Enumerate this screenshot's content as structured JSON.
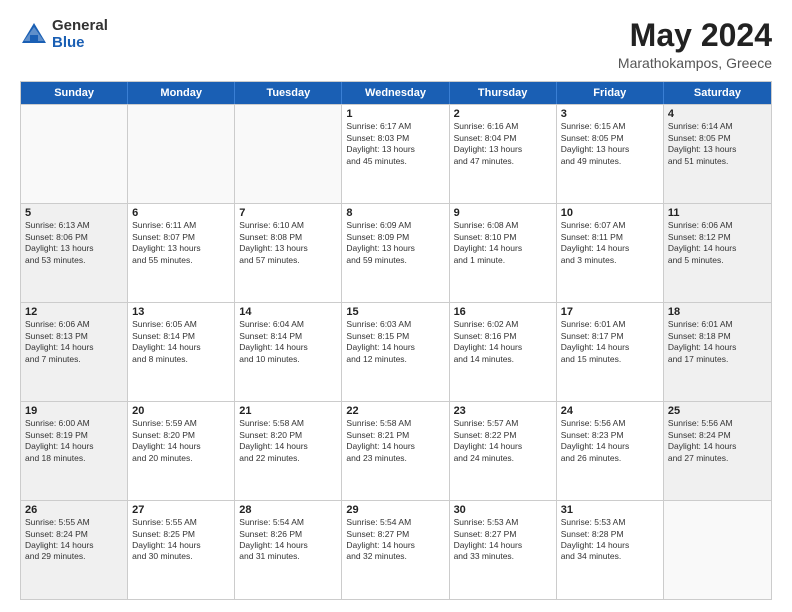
{
  "logo": {
    "general": "General",
    "blue": "Blue"
  },
  "title": "May 2024",
  "location": "Marathokampos, Greece",
  "days_of_week": [
    "Sunday",
    "Monday",
    "Tuesday",
    "Wednesday",
    "Thursday",
    "Friday",
    "Saturday"
  ],
  "weeks": [
    [
      {
        "day": "",
        "info": ""
      },
      {
        "day": "",
        "info": ""
      },
      {
        "day": "",
        "info": ""
      },
      {
        "day": "1",
        "info": "Sunrise: 6:17 AM\nSunset: 8:03 PM\nDaylight: 13 hours\nand 45 minutes."
      },
      {
        "day": "2",
        "info": "Sunrise: 6:16 AM\nSunset: 8:04 PM\nDaylight: 13 hours\nand 47 minutes."
      },
      {
        "day": "3",
        "info": "Sunrise: 6:15 AM\nSunset: 8:05 PM\nDaylight: 13 hours\nand 49 minutes."
      },
      {
        "day": "4",
        "info": "Sunrise: 6:14 AM\nSunset: 8:05 PM\nDaylight: 13 hours\nand 51 minutes."
      }
    ],
    [
      {
        "day": "5",
        "info": "Sunrise: 6:13 AM\nSunset: 8:06 PM\nDaylight: 13 hours\nand 53 minutes."
      },
      {
        "day": "6",
        "info": "Sunrise: 6:11 AM\nSunset: 8:07 PM\nDaylight: 13 hours\nand 55 minutes."
      },
      {
        "day": "7",
        "info": "Sunrise: 6:10 AM\nSunset: 8:08 PM\nDaylight: 13 hours\nand 57 minutes."
      },
      {
        "day": "8",
        "info": "Sunrise: 6:09 AM\nSunset: 8:09 PM\nDaylight: 13 hours\nand 59 minutes."
      },
      {
        "day": "9",
        "info": "Sunrise: 6:08 AM\nSunset: 8:10 PM\nDaylight: 14 hours\nand 1 minute."
      },
      {
        "day": "10",
        "info": "Sunrise: 6:07 AM\nSunset: 8:11 PM\nDaylight: 14 hours\nand 3 minutes."
      },
      {
        "day": "11",
        "info": "Sunrise: 6:06 AM\nSunset: 8:12 PM\nDaylight: 14 hours\nand 5 minutes."
      }
    ],
    [
      {
        "day": "12",
        "info": "Sunrise: 6:06 AM\nSunset: 8:13 PM\nDaylight: 14 hours\nand 7 minutes."
      },
      {
        "day": "13",
        "info": "Sunrise: 6:05 AM\nSunset: 8:14 PM\nDaylight: 14 hours\nand 8 minutes."
      },
      {
        "day": "14",
        "info": "Sunrise: 6:04 AM\nSunset: 8:14 PM\nDaylight: 14 hours\nand 10 minutes."
      },
      {
        "day": "15",
        "info": "Sunrise: 6:03 AM\nSunset: 8:15 PM\nDaylight: 14 hours\nand 12 minutes."
      },
      {
        "day": "16",
        "info": "Sunrise: 6:02 AM\nSunset: 8:16 PM\nDaylight: 14 hours\nand 14 minutes."
      },
      {
        "day": "17",
        "info": "Sunrise: 6:01 AM\nSunset: 8:17 PM\nDaylight: 14 hours\nand 15 minutes."
      },
      {
        "day": "18",
        "info": "Sunrise: 6:01 AM\nSunset: 8:18 PM\nDaylight: 14 hours\nand 17 minutes."
      }
    ],
    [
      {
        "day": "19",
        "info": "Sunrise: 6:00 AM\nSunset: 8:19 PM\nDaylight: 14 hours\nand 18 minutes."
      },
      {
        "day": "20",
        "info": "Sunrise: 5:59 AM\nSunset: 8:20 PM\nDaylight: 14 hours\nand 20 minutes."
      },
      {
        "day": "21",
        "info": "Sunrise: 5:58 AM\nSunset: 8:20 PM\nDaylight: 14 hours\nand 22 minutes."
      },
      {
        "day": "22",
        "info": "Sunrise: 5:58 AM\nSunset: 8:21 PM\nDaylight: 14 hours\nand 23 minutes."
      },
      {
        "day": "23",
        "info": "Sunrise: 5:57 AM\nSunset: 8:22 PM\nDaylight: 14 hours\nand 24 minutes."
      },
      {
        "day": "24",
        "info": "Sunrise: 5:56 AM\nSunset: 8:23 PM\nDaylight: 14 hours\nand 26 minutes."
      },
      {
        "day": "25",
        "info": "Sunrise: 5:56 AM\nSunset: 8:24 PM\nDaylight: 14 hours\nand 27 minutes."
      }
    ],
    [
      {
        "day": "26",
        "info": "Sunrise: 5:55 AM\nSunset: 8:24 PM\nDaylight: 14 hours\nand 29 minutes."
      },
      {
        "day": "27",
        "info": "Sunrise: 5:55 AM\nSunset: 8:25 PM\nDaylight: 14 hours\nand 30 minutes."
      },
      {
        "day": "28",
        "info": "Sunrise: 5:54 AM\nSunset: 8:26 PM\nDaylight: 14 hours\nand 31 minutes."
      },
      {
        "day": "29",
        "info": "Sunrise: 5:54 AM\nSunset: 8:27 PM\nDaylight: 14 hours\nand 32 minutes."
      },
      {
        "day": "30",
        "info": "Sunrise: 5:53 AM\nSunset: 8:27 PM\nDaylight: 14 hours\nand 33 minutes."
      },
      {
        "day": "31",
        "info": "Sunrise: 5:53 AM\nSunset: 8:28 PM\nDaylight: 14 hours\nand 34 minutes."
      },
      {
        "day": "",
        "info": ""
      }
    ]
  ]
}
